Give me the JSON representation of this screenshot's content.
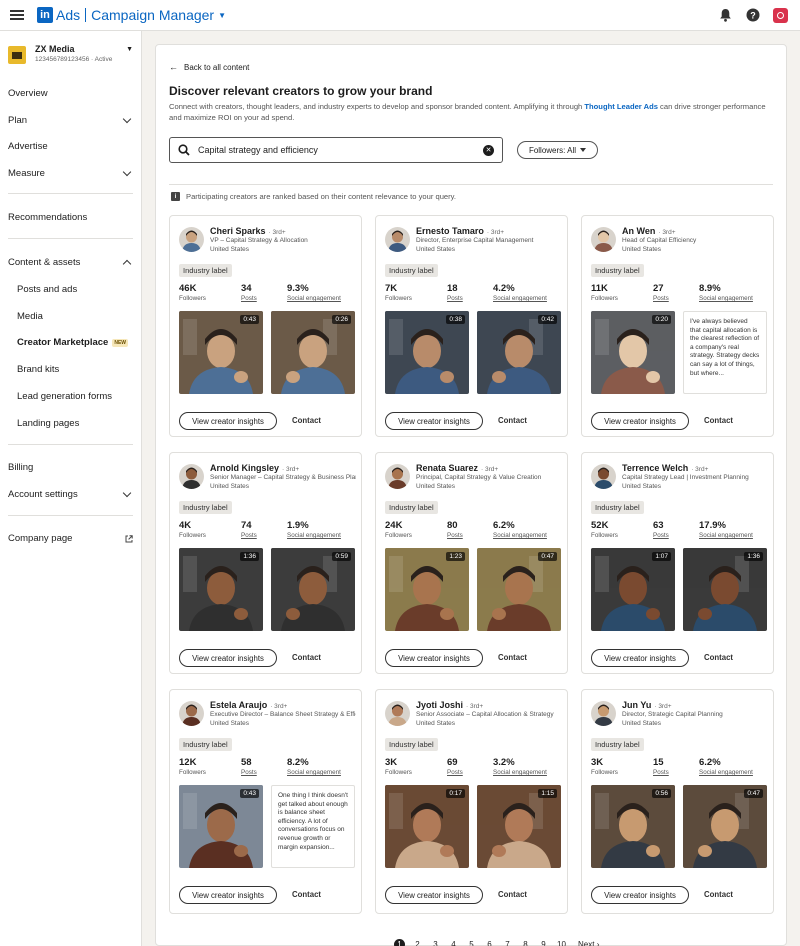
{
  "topbar": {
    "app_ads": "Ads",
    "app_name": "Campaign Manager",
    "icons": [
      "menu-icon",
      "bell-icon",
      "help-icon",
      "profile-icon"
    ]
  },
  "account": {
    "name": "ZX Media",
    "id_status": "123456789123456 · Active"
  },
  "nav": {
    "overview": "Overview",
    "plan": "Plan",
    "advertise": "Advertise",
    "measure": "Measure",
    "recommendations": "Recommendations",
    "content_assets": "Content & assets",
    "posts_ads": "Posts and ads",
    "media": "Media",
    "creator_marketplace": "Creator Marketplace",
    "new_badge": "NEW",
    "brand_kits": "Brand kits",
    "lead_forms": "Lead generation forms",
    "landing_pages": "Landing pages",
    "billing": "Billing",
    "account_settings": "Account settings",
    "company_page": "Company page"
  },
  "main": {
    "back": "Back to all content",
    "title": "Discover relevant creators to grow your brand",
    "desc_pre": "Connect with creators, thought leaders, and industry experts to develop and sponsor branded content. Amplifying it through ",
    "desc_link": "Thought Leader Ads",
    "desc_post": " can drive stronger performance and maximize ROI on your ad spend.",
    "search_value": "Capital strategy and efficiency",
    "filter_label": "Followers: All",
    "ranking_note": "Participating creators are ranked based on their content relevance to your query.",
    "insights_label": "View creator insights",
    "contact_label": "Contact",
    "followers_label": "Followers",
    "posts_label": "Posts",
    "engagement_label": "Social engagement"
  },
  "creators": [
    {
      "name": "Cheri Sparks",
      "degree": "· 3rd+",
      "title": "VP – Capital Strategy & Allocation",
      "location": "United States",
      "label": "Industry label",
      "followers": "46K",
      "posts": "34",
      "engagement": "9.3%",
      "media": [
        {
          "type": "video",
          "duration": "0:43"
        },
        {
          "type": "video",
          "duration": "0:26"
        }
      ]
    },
    {
      "name": "Ernesto Tamaro",
      "degree": "· 3rd+",
      "title": "Director, Enterprise Capital Management",
      "location": "United States",
      "label": "Industry label",
      "followers": "7K",
      "posts": "18",
      "engagement": "4.2%",
      "media": [
        {
          "type": "video",
          "duration": "0:38"
        },
        {
          "type": "video",
          "duration": "0:42"
        }
      ]
    },
    {
      "name": "An Wen",
      "degree": "· 3rd+",
      "title": "Head of Capital Efficiency",
      "location": "United States",
      "label": "Industry label",
      "followers": "11K",
      "posts": "27",
      "engagement": "8.9%",
      "media": [
        {
          "type": "video",
          "duration": "0:20"
        },
        {
          "type": "text",
          "text": "I've always believed that capital allocation is the clearest reflection of a company's real strategy. Strategy decks can say a lot of things, but where..."
        }
      ]
    },
    {
      "name": "Arnold Kingsley",
      "degree": "· 3rd+",
      "title": "Senior Manager – Capital Strategy & Business Planning",
      "location": "United States",
      "label": "Industry label",
      "followers": "4K",
      "posts": "74",
      "engagement": "1.9%",
      "media": [
        {
          "type": "video",
          "duration": "1:36"
        },
        {
          "type": "video",
          "duration": "0:59"
        }
      ]
    },
    {
      "name": "Renata Suarez",
      "degree": "· 3rd+",
      "title": "Principal, Capital Strategy & Value Creation",
      "location": "United States",
      "label": "Industry label",
      "followers": "24K",
      "posts": "80",
      "engagement": "6.2%",
      "media": [
        {
          "type": "video",
          "duration": "1:23"
        },
        {
          "type": "video",
          "duration": "0:47"
        }
      ]
    },
    {
      "name": "Terrence Welch",
      "degree": "· 3rd+",
      "title": "Capital Strategy Lead | Investment Planning",
      "location": "United States",
      "label": "Industry label",
      "followers": "52K",
      "posts": "63",
      "engagement": "17.9%",
      "media": [
        {
          "type": "video",
          "duration": "1:07"
        },
        {
          "type": "video",
          "duration": "1:36"
        }
      ]
    },
    {
      "name": "Estela Araujo",
      "degree": "· 3rd+",
      "title": "Executive Director – Balance Sheet Strategy & Efficiency",
      "location": "United States",
      "label": "Industry label",
      "followers": "12K",
      "posts": "58",
      "engagement": "8.2%",
      "media": [
        {
          "type": "video",
          "duration": "0:43"
        },
        {
          "type": "text",
          "text": "One thing I think doesn't get talked about enough is balance sheet efficiency. A lot of conversations focus on revenue growth or margin expansion..."
        }
      ]
    },
    {
      "name": "Jyoti Joshi",
      "degree": "· 3rd+",
      "title": "Senior Associate – Capital Allocation & Strategy",
      "location": "United States",
      "label": "Industry label",
      "followers": "3K",
      "posts": "69",
      "engagement": "3.2%",
      "media": [
        {
          "type": "video",
          "duration": "0:17"
        },
        {
          "type": "video",
          "duration": "1:15"
        }
      ]
    },
    {
      "name": "Jun Yu",
      "degree": "· 3rd+",
      "title": "Director, Strategic Capital Planning",
      "location": "United States",
      "label": "Industry label",
      "followers": "3K",
      "posts": "15",
      "engagement": "6.2%",
      "media": [
        {
          "type": "video",
          "duration": "0:56"
        },
        {
          "type": "video",
          "duration": "0:47"
        }
      ]
    }
  ],
  "pagination": {
    "pages": [
      "1",
      "2",
      "3",
      "4",
      "5",
      "6",
      "7",
      "8",
      "9",
      "10"
    ],
    "current": "1",
    "next": "Next"
  }
}
